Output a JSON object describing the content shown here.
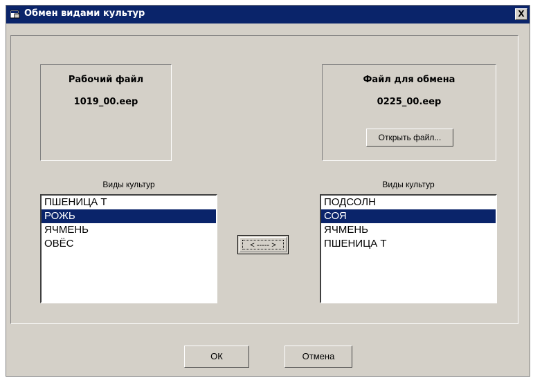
{
  "window": {
    "title": "Обмен видами культур",
    "close_label": "X"
  },
  "working_file": {
    "heading": "Рабочий файл",
    "filename": "1019_00.eep"
  },
  "exchange_file": {
    "heading": "Файл для обмена",
    "filename": "0225_00.eep",
    "open_button": "Открыть файл..."
  },
  "left_list": {
    "label": "Виды культур",
    "items": [
      {
        "text": "ПШЕНИЦА Т",
        "selected": false
      },
      {
        "text": "РОЖЬ",
        "selected": true
      },
      {
        "text": "ЯЧМЕНЬ",
        "selected": false
      },
      {
        "text": "ОВЁС",
        "selected": false
      }
    ]
  },
  "right_list": {
    "label": "Виды культур",
    "items": [
      {
        "text": "ПОДСОЛН",
        "selected": false
      },
      {
        "text": "СОЯ",
        "selected": true
      },
      {
        "text": "ЯЧМЕНЬ",
        "selected": false
      },
      {
        "text": "ПШЕНИЦА Т",
        "selected": false
      }
    ]
  },
  "swap_button": "< ----- >",
  "ok_button": "ОК",
  "cancel_button": "Отмена",
  "colors": {
    "face": "#d4d0c8",
    "titlebar": "#0a246a",
    "selection": "#0a246a"
  },
  "icons": {
    "title": "window-app-icon"
  }
}
